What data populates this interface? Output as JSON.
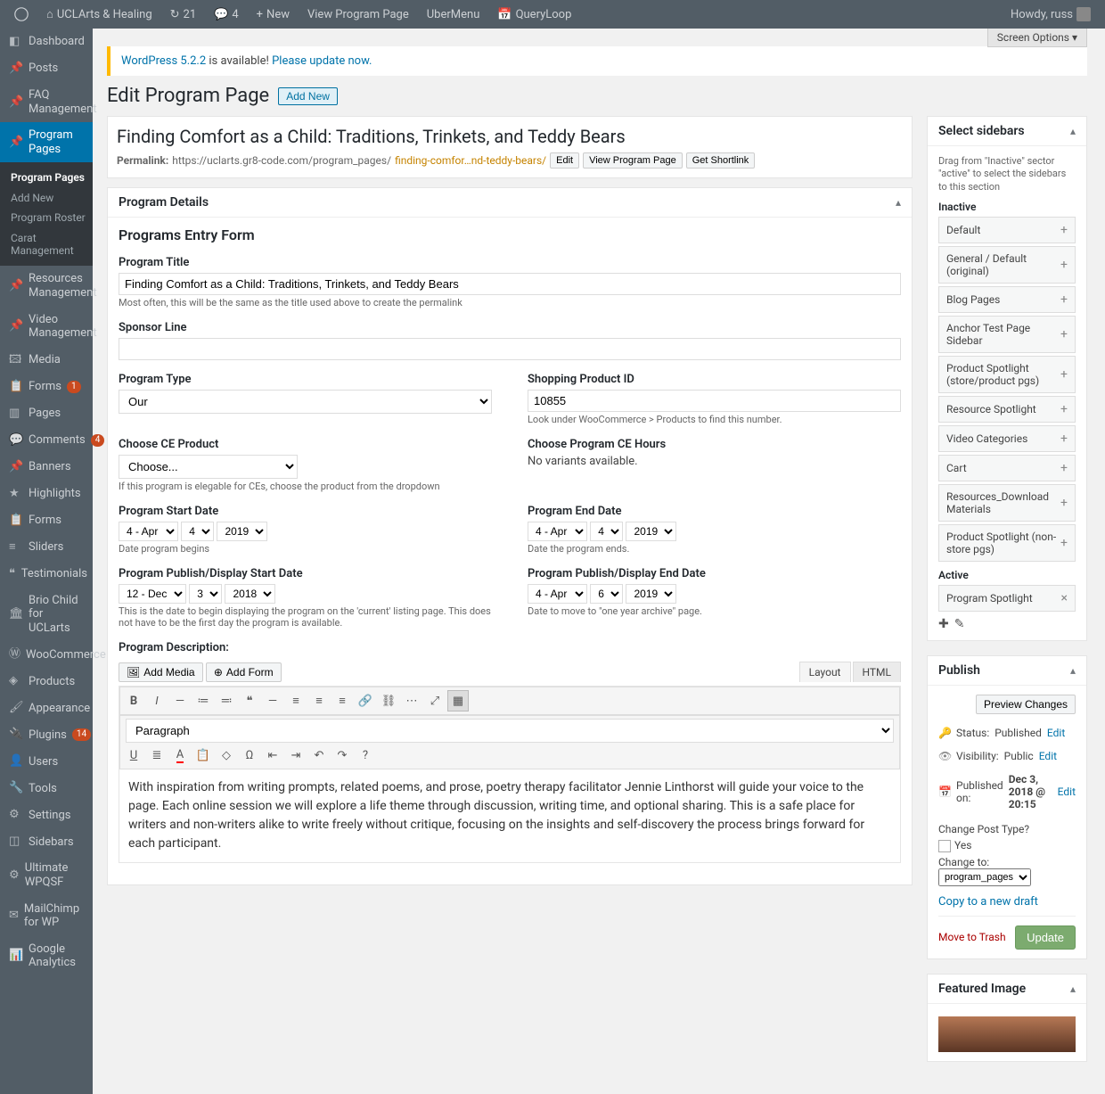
{
  "adminbar": {
    "site": "UCLArts & Healing",
    "updates": "21",
    "comments": "4",
    "new": "New",
    "view": "View Program Page",
    "ubermenu": "UberMenu",
    "queryloop": "QueryLoop",
    "howdy": "Howdy, russ"
  },
  "sidemenu": {
    "dashboard": "Dashboard",
    "posts": "Posts",
    "faq": "FAQ Management",
    "program_pages": "Program Pages",
    "submenu": {
      "program_pages": "Program Pages",
      "add_new": "Add New",
      "program_roster": "Program Roster",
      "carat": "Carat Management"
    },
    "resources": "Resources Management",
    "video": "Video Management",
    "media": "Media",
    "forms": "Forms",
    "forms_badge": "1",
    "pages": "Pages",
    "comments": "Comments",
    "comments_badge": "4",
    "banners": "Banners",
    "highlights": "Highlights",
    "forms2": "Forms",
    "sliders": "Sliders",
    "testimonials": "Testimonials",
    "brio": "Brio Child for UCLarts",
    "woo": "WooCommerce",
    "products": "Products",
    "appearance": "Appearance",
    "plugins": "Plugins",
    "plugins_badge": "14",
    "users": "Users",
    "tools": "Tools",
    "settings": "Settings",
    "sidebars": "Sidebars",
    "wpqsf": "Ultimate WPQSF",
    "mailchimp": "MailChimp for WP",
    "ga": "Google Analytics"
  },
  "screen_options": "Screen Options",
  "update_nag": {
    "pre": "WordPress 5.2.2",
    "mid": " is available! ",
    "link": "Please update now."
  },
  "header": {
    "title": "Edit Program Page",
    "add_new": "Add New"
  },
  "post": {
    "title": "Finding Comfort as a Child: Traditions, Trinkets, and Teddy Bears",
    "perm_label": "Permalink:",
    "perm_base": "https://uclarts.gr8-code.com/program_pages/",
    "perm_slug": "finding-comfor…nd-teddy-bears/",
    "edit": "Edit",
    "view": "View Program Page",
    "shortlink": "Get Shortlink"
  },
  "panel": {
    "program_details": "Program Details",
    "form_title": "Programs Entry Form"
  },
  "fields": {
    "program_title": {
      "label": "Program Title",
      "value": "Finding Comfort as a Child: Traditions, Trinkets, and Teddy Bears",
      "hint": "Most often, this will be the same as the title used above to create the permalink"
    },
    "sponsor": {
      "label": "Sponsor Line",
      "value": ""
    },
    "program_type": {
      "label": "Program Type",
      "value": "Our"
    },
    "product_id": {
      "label": "Shopping Product ID",
      "value": "10855",
      "hint": "Look under WooCommerce > Products to find this number."
    },
    "ce_product": {
      "label": "Choose CE Product",
      "value": "Choose...",
      "hint": "If this program is elegable for CEs, choose the product from the dropdown"
    },
    "ce_hours": {
      "label": "Choose Program CE Hours",
      "msg": "No variants available."
    },
    "start_date": {
      "label": "Program Start Date",
      "m": "4 - Apr",
      "d": "4",
      "y": "2019",
      "hint": "Date program begins"
    },
    "end_date": {
      "label": "Program End Date",
      "m": "4 - Apr",
      "d": "4",
      "y": "2019",
      "hint": "Date the program ends."
    },
    "pub_start": {
      "label": "Program Publish/Display Start Date",
      "m": "12 - Dec",
      "d": "3",
      "y": "2018",
      "hint": "This is the date to begin displaying the program on the 'current' listing page. This does not have to be the first day the program is available."
    },
    "pub_end": {
      "label": "Program Publish/Display End Date",
      "m": "4 - Apr",
      "d": "6",
      "y": "2019",
      "hint": "Date to move to \"one year archive\" page."
    },
    "description": {
      "label": "Program Description:"
    }
  },
  "editor": {
    "add_media": "Add Media",
    "add_form": "Add Form",
    "tab_layout": "Layout",
    "tab_html": "HTML",
    "para": "Paragraph",
    "content": "With inspiration from writing prompts, related poems, and prose, poetry therapy facilitator Jennie Linthorst will guide your voice to the page. Each online session we will explore a life theme through discussion, writing time, and optional sharing. This is a safe place for writers and non-writers alike to write freely without critique, focusing on the insights and self-discovery the process brings forward for each participant."
  },
  "sidebars_box": {
    "title": "Select sidebars",
    "desc": "Drag from \"Inactive\" sector \"active\" to select the sidebars to this section",
    "inactive_label": "Inactive",
    "active_label": "Active",
    "inactive": [
      "Default",
      "General / Default (original)",
      "Blog Pages",
      "Anchor Test Page Sidebar",
      "Product Spotlight (store/product pgs)",
      "Resource Spotlight",
      "Video Categories",
      "Cart",
      "Resources_Download Materials",
      "Product Spotlight (non-store pgs)"
    ],
    "active": [
      "Program Spotlight"
    ]
  },
  "publish": {
    "title": "Publish",
    "preview": "Preview Changes",
    "status_label": "Status:",
    "status": "Published",
    "visibility_label": "Visibility:",
    "visibility": "Public",
    "published_label": "Published on:",
    "published": "Dec 3, 2018 @ 20:15",
    "edit": "Edit",
    "change_type": "Change Post Type?",
    "yes": "Yes",
    "change_to": "Change to:",
    "change_val": "program_pages",
    "copy": "Copy to a new draft",
    "trash": "Move to Trash",
    "update": "Update"
  },
  "featured": {
    "title": "Featured Image"
  }
}
